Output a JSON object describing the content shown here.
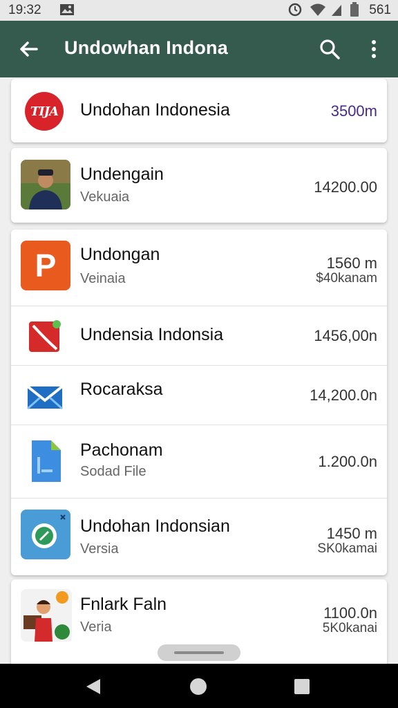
{
  "status_bar": {
    "time": "19:32",
    "battery_text": "561"
  },
  "app_bar": {
    "title": "Undowhan Indona"
  },
  "items": [
    {
      "name": "Undohan Indonesia",
      "price": "3500m",
      "icon_text": "TIJA"
    },
    {
      "name": "Undengain",
      "sub": "Vekuaia",
      "price": "14200.00"
    },
    {
      "name": "Undongan",
      "sub": "Veinaia",
      "price": "1560 m",
      "price2": "$40kanam",
      "icon_text": "P"
    },
    {
      "name": "Undensia Indonsia",
      "price": "1456,00n"
    },
    {
      "name": "Rocaraksa",
      "price": "14,200.0n"
    },
    {
      "name": "Pachonam",
      "sub": "Sodad File",
      "price": "1.200.0n"
    },
    {
      "name": "Undohan Indonsian",
      "sub": "Versia",
      "price": "1450 m",
      "price2": "SK0kamai"
    },
    {
      "name": "Fnlark Faln",
      "sub": "Veria",
      "price": "1100.0n",
      "price2": "5K0kanai"
    }
  ],
  "colors": {
    "app_bar": "#355b4e",
    "price_accent": "#4b2a86"
  }
}
